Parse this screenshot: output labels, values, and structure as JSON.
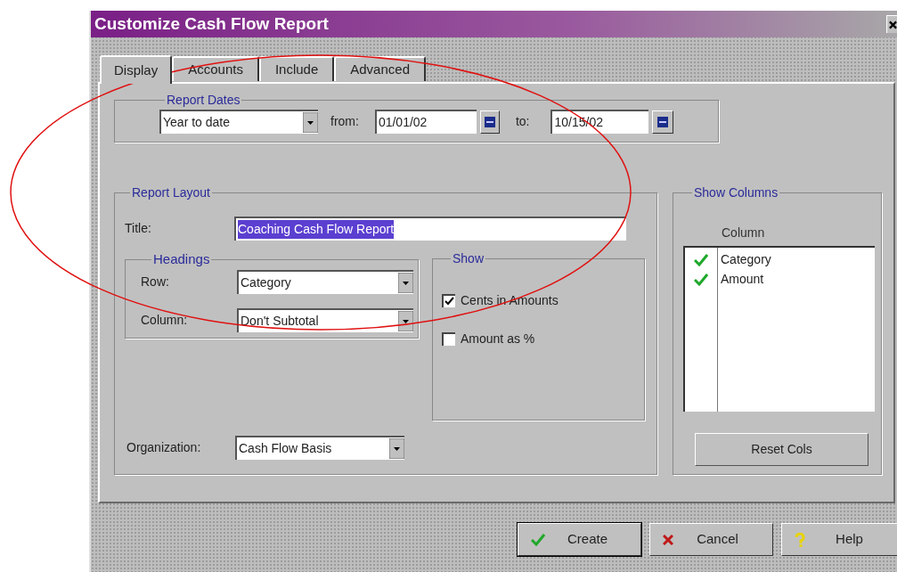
{
  "window": {
    "title": "Customize Cash Flow Report"
  },
  "tabs": [
    {
      "label": "Display",
      "selected": true
    },
    {
      "label": "Accounts",
      "selected": false
    },
    {
      "label": "Include",
      "selected": false
    },
    {
      "label": "Advanced",
      "selected": false
    }
  ],
  "report_dates": {
    "legend": "Report Dates",
    "range": "Year to date",
    "from_label": "from:",
    "from": "01/01/02",
    "to_label": "to:",
    "to": "10/15/02"
  },
  "report_layout": {
    "legend": "Report Layout",
    "title_label": "Title:",
    "title": "Coaching Cash Flow Report",
    "title_selected": true,
    "headings": {
      "legend": "Headings",
      "row_label": "Row:",
      "row": "Category",
      "column_label": "Column:",
      "column": "Don't Subtotal"
    },
    "show": {
      "legend": "Show",
      "options": [
        {
          "label": "Cents in Amounts",
          "checked": true
        },
        {
          "label": "Amount as %",
          "checked": false
        }
      ]
    },
    "organization_label": "Organization:",
    "organization": "Cash Flow Basis"
  },
  "show_columns": {
    "legend": "Show Columns",
    "header": "Column",
    "items": [
      {
        "label": "Category",
        "checked": true
      },
      {
        "label": "Amount",
        "checked": true
      }
    ],
    "reset_button": "Reset Cols"
  },
  "buttons": [
    {
      "kind": "create",
      "label": "Create"
    },
    {
      "kind": "cancel",
      "label": "Cancel"
    },
    {
      "kind": "help",
      "label": "Help"
    }
  ]
}
